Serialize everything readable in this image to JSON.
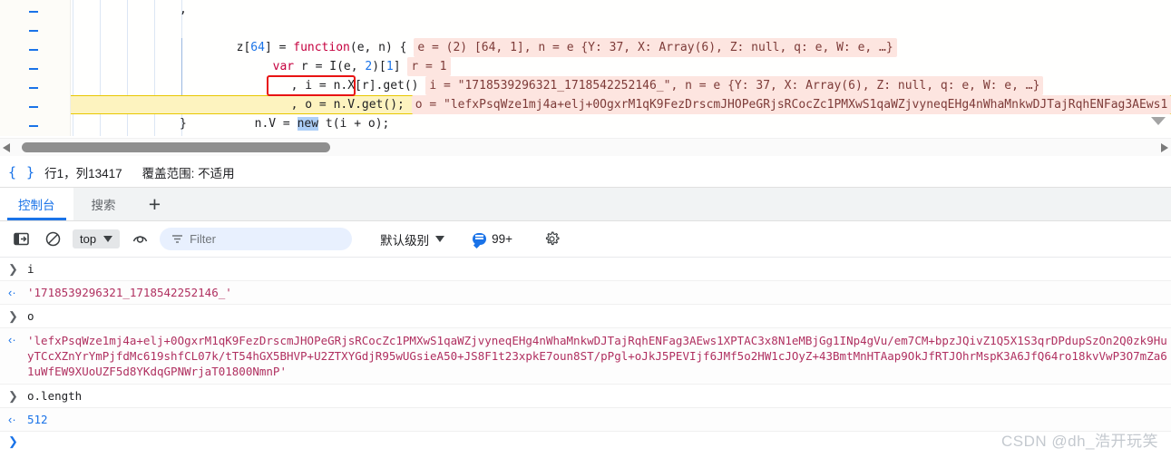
{
  "sources": {
    "gutter_marks": [
      "-",
      "-",
      "-",
      "-",
      "-",
      "-",
      "-"
    ],
    "lines": [
      {
        "indent": 120,
        "code": ",",
        "eval": ""
      },
      {
        "indent": 120,
        "code": "z[64] = function(e, n) {",
        "eval": "e = (2) [64, 1], n = e {Y: 37, X: Array(6), Z: null, q: e, W: e, …}"
      },
      {
        "indent": 160,
        "code": "var r = I(e, 2)[1]",
        "eval": "r = 1"
      },
      {
        "indent": 180,
        "code": ", i = n.X[r].get()",
        "eval": "i = \"1718539296321_1718542252146_\", n = e {Y: 37, X: Array(6), Z: null, q: e, W: e, …}"
      },
      {
        "indent": 180,
        "code": ", o = n.V.get();",
        "eval": "o = \"lefxPsqWze1mj4a+elj+0OgxrM1qK9FezDrscmJHOPeGRjsRCocZc1PMXwS1qaWZjvyneqEHg4nWhaMnkwDJTajRqhENFag3AEws1"
      },
      {
        "indent": 140,
        "code_pre": "n.V = ",
        "code_kw": "new",
        "code_post": " t(i + o);",
        "eval": ""
      },
      {
        "indent": 120,
        "code": "}",
        "eval": ""
      }
    ],
    "annotation": "red-highlight-box-around-n-v-get"
  },
  "statusbar": {
    "format_icon": "{ }",
    "position": "行1，列13417",
    "coverage": "覆盖范围: 不适用"
  },
  "drawer_tabs": {
    "tabs": [
      {
        "label": "控制台",
        "active": true
      },
      {
        "label": "搜索",
        "active": false
      }
    ],
    "add_label": "+"
  },
  "console_toolbar": {
    "sidebar_toggle": "sidebar-toggle-icon",
    "clear_label": "clear-console-icon",
    "context": "top",
    "eye_label": "live-expression-icon",
    "filter_placeholder": "Filter",
    "level": "默认级别",
    "issues_count": "99+",
    "settings_label": "settings-gear-icon"
  },
  "console": {
    "entries": [
      {
        "kind": "input",
        "marker": "❯",
        "text": "i"
      },
      {
        "kind": "output",
        "marker": "‹·",
        "text": "'1718539296321_1718542252146_'"
      },
      {
        "kind": "input",
        "marker": "❯",
        "text": "o"
      },
      {
        "kind": "output",
        "marker": "‹·",
        "text": "'lefxPsqWze1mj4a+elj+0OgxrM1qK9FezDrscmJHOPeGRjsRCocZc1PMXwS1qaWZjvyneqEHg4nWhaMnkwDJTajRqhENFag3AEws1XPTAC3x8N1eMBjGg1INp4gVu/em7CM+bpzJQivZ1Q5X1S3qrDPdupSzOn2Q0zk9HuyTCcXZnYrYmPjfdMc619shfCL07k/tT54hGX5BHVP+U2ZTXYGdjR95wUGsieA50+JS8F1t23xpkE7oun8ST/pPgl+oJkJ5PEVIjf6JMf5o2HW1cJOyZ+43BmtMnHTAap9OkJfRTJOhrMspK3A6JfQ64ro18kvVwP3O7mZa61uWfEW9XUoUZF5d8YKdqGPNWrjaT01800NmnP'"
      },
      {
        "kind": "input",
        "marker": "❯",
        "text": "o.length"
      },
      {
        "kind": "output",
        "marker": "‹·",
        "text": "512"
      }
    ],
    "prompt_marker": "❯"
  },
  "watermark": "CSDN @dh_浩开玩笑",
  "colors": {
    "accent": "#1a73e8",
    "keyword": "#c5003e",
    "eval_chip_bg": "#fde5e0",
    "highlight_row": "#fdf3bf",
    "annotation": "#e81313",
    "string": "#b03060"
  }
}
